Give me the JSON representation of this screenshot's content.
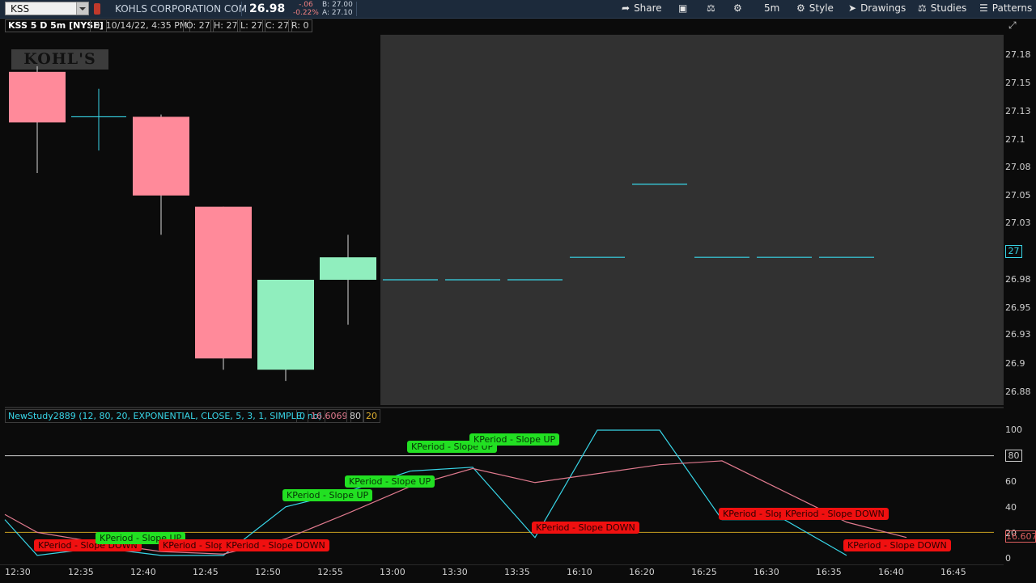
{
  "toolbar": {
    "symbol": "KSS",
    "company": "KOHLS CORPORATION COM",
    "last": "26.98",
    "change": "-.06",
    "change_pct": "-0.22%",
    "bid": "B: 27.00",
    "ask": "A: 27.10",
    "share": "Share",
    "interval": "5m",
    "style": "Style",
    "drawings": "Drawings",
    "studies": "Studies",
    "patterns": "Patterns"
  },
  "chart_header": {
    "title": "KSS 5 D 5m [NYSE]",
    "date": "D: 10/14/22, 4:35 PM",
    "open": "O: 27",
    "high": "H: 27",
    "low": "L: 27",
    "close": "C: 27",
    "range": "R: 0"
  },
  "logo_text": "KOHL'S",
  "price_axis": [
    "27.18",
    "27.15",
    "27.13",
    "27.1",
    "27.08",
    "27.05",
    "27.03",
    "26.98",
    "26.95",
    "26.93",
    "26.9",
    "26.88"
  ],
  "price_tag": "27",
  "study": {
    "name": "NewStudy2889 (12, 80, 20, EXPONENTIAL, CLOSE, 5, 3, 1, SIMPLE, no)",
    "v0": "0",
    "v1": "16.6069",
    "v2": "80",
    "v3": "20"
  },
  "osc_axis": [
    "100",
    "60",
    "40",
    "20",
    "0"
  ],
  "osc_box80": "80",
  "osc_box16": "16.607",
  "time_axis": [
    "12:30",
    "12:35",
    "12:40",
    "12:45",
    "12:50",
    "12:55",
    "13:00",
    "13:30",
    "13:35",
    "16:10",
    "16:20",
    "16:25",
    "16:30",
    "16:35",
    "16:40",
    "16:45"
  ],
  "bubbles": [
    {
      "text": "KPeriod - Slope DOWN",
      "type": "down"
    },
    {
      "text": "KPeriod - Slope UP",
      "type": "up"
    },
    {
      "text": "KPeriod - Slope DOWN",
      "type": "down"
    },
    {
      "text": "KPeriod - Slope DOWN",
      "type": "down"
    },
    {
      "text": "KPeriod - Slope UP",
      "type": "up"
    },
    {
      "text": "KPeriod - Slope UP",
      "type": "up"
    },
    {
      "text": "KPeriod - Slope UP",
      "type": "up"
    },
    {
      "text": "KPeriod - Slope UP",
      "type": "up"
    },
    {
      "text": "KPeriod - Slope DOWN",
      "type": "down"
    },
    {
      "text": "KPeriod - Slope DOWN",
      "type": "down"
    },
    {
      "text": "KPeriod - Slope DOWN",
      "type": "down"
    },
    {
      "text": "KPeriod - Slope DOWN",
      "type": "down"
    }
  ],
  "colors": {
    "up_candle": "#90EEBE",
    "down_candle": "#FF8A9A",
    "k_line": "#38D6E8",
    "d_line": "#E07A8E",
    "level_20": "#C8A020",
    "level_80": "#CFCFCF"
  },
  "chart_data": {
    "type": "candlestick",
    "price_candles": [
      {
        "o": 27.165,
        "h": 27.17,
        "l": 27.075,
        "c": 27.12
      },
      {
        "o": 27.125,
        "h": 27.15,
        "l": 27.095,
        "c": 27.125
      },
      {
        "o": 27.125,
        "h": 27.127,
        "l": 27.02,
        "c": 27.055
      },
      {
        "o": 27.045,
        "h": 27.045,
        "l": 26.9,
        "c": 26.91
      },
      {
        "o": 26.9,
        "h": 26.98,
        "l": 26.89,
        "c": 26.98
      },
      {
        "o": 26.98,
        "h": 27.02,
        "l": 26.94,
        "c": 27.0
      }
    ],
    "future_bars": [
      26.98,
      26.98,
      26.98,
      27.0,
      27.065,
      27.0,
      27.0,
      27.0
    ],
    "k_series": [
      30,
      2,
      8,
      4,
      2,
      2,
      3,
      26,
      50,
      68,
      71,
      74,
      20,
      100,
      100,
      52,
      32,
      32,
      2
    ],
    "d_series": [
      35,
      19,
      12,
      7,
      4,
      3,
      2,
      13,
      33,
      55,
      69,
      59,
      66,
      74,
      76,
      54,
      38,
      25,
      15
    ],
    "levels": [
      80,
      20
    ],
    "ylim": [
      0,
      100
    ]
  }
}
